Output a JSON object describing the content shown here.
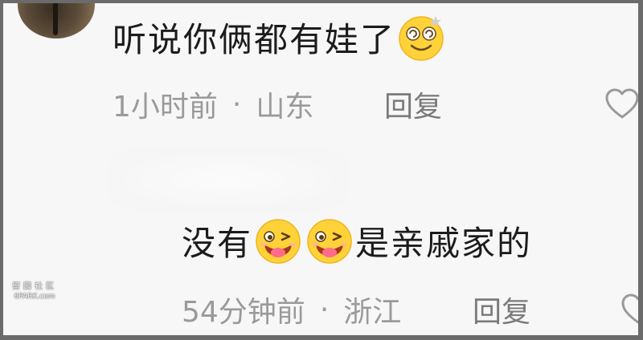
{
  "comments": [
    {
      "text": "听说你俩都有娃了",
      "emojis": [
        "dizzy-smile-emoji"
      ],
      "time": "1小时前",
      "separator": "·",
      "location": "山东",
      "reply_label": "回复",
      "like_icon": "heart-outline-icon"
    },
    {
      "text_before": "没有",
      "emojis": [
        "wink-tongue-emoji",
        "wink-tongue-emoji"
      ],
      "text_after": "是亲戚家的",
      "time": "54分钟前",
      "separator": "·",
      "location": "浙江",
      "reply_label": "回复",
      "like_icon": "heart-outline-icon"
    }
  ],
  "watermark": {
    "line1": "留园社区",
    "line2": "6PARK.com"
  },
  "colors": {
    "text": "#1c1c1c",
    "meta": "#9a9a9a",
    "background": "#f7f7f7",
    "emoji_yellow": "#ffd23a"
  }
}
